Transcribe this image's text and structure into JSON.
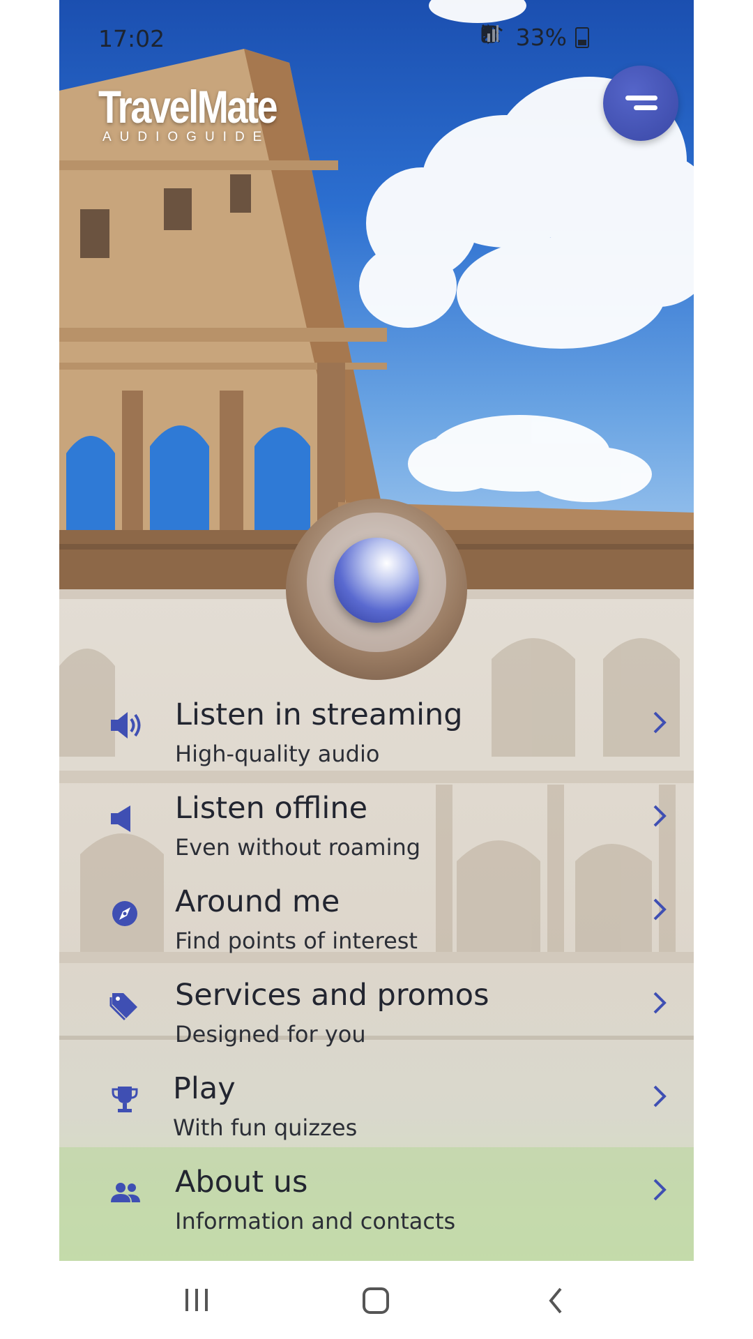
{
  "status_bar": {
    "time": "17:02",
    "battery_percent": "33%",
    "icons": [
      "data-saver-icon",
      "bluetooth-icon",
      "mute-icon",
      "wifi-icon",
      "signal-icon",
      "battery-icon"
    ]
  },
  "app": {
    "logo_main": "TravelMate",
    "logo_sub": "AUDIOGUIDE"
  },
  "colors": {
    "accent": "#3f4fb3",
    "text_primary": "#222530"
  },
  "menu": {
    "items": [
      {
        "title": "Listen in streaming",
        "subtitle": "High-quality audio",
        "icon": "speaker-loud-icon"
      },
      {
        "title": "Listen offline",
        "subtitle": "Even without roaming",
        "icon": "speaker-icon"
      },
      {
        "title": "Around me",
        "subtitle": "Find points of interest",
        "icon": "compass-icon"
      },
      {
        "title": "Services and promos",
        "subtitle": "Designed for you",
        "icon": "tag-icon"
      },
      {
        "title": "Play",
        "subtitle": "With fun quizzes",
        "icon": "trophy-icon"
      },
      {
        "title": "About us",
        "subtitle": "Information and contacts",
        "icon": "people-icon"
      }
    ]
  },
  "nav_bar": {
    "buttons": [
      "recent-apps-icon",
      "home-icon",
      "back-icon"
    ]
  }
}
